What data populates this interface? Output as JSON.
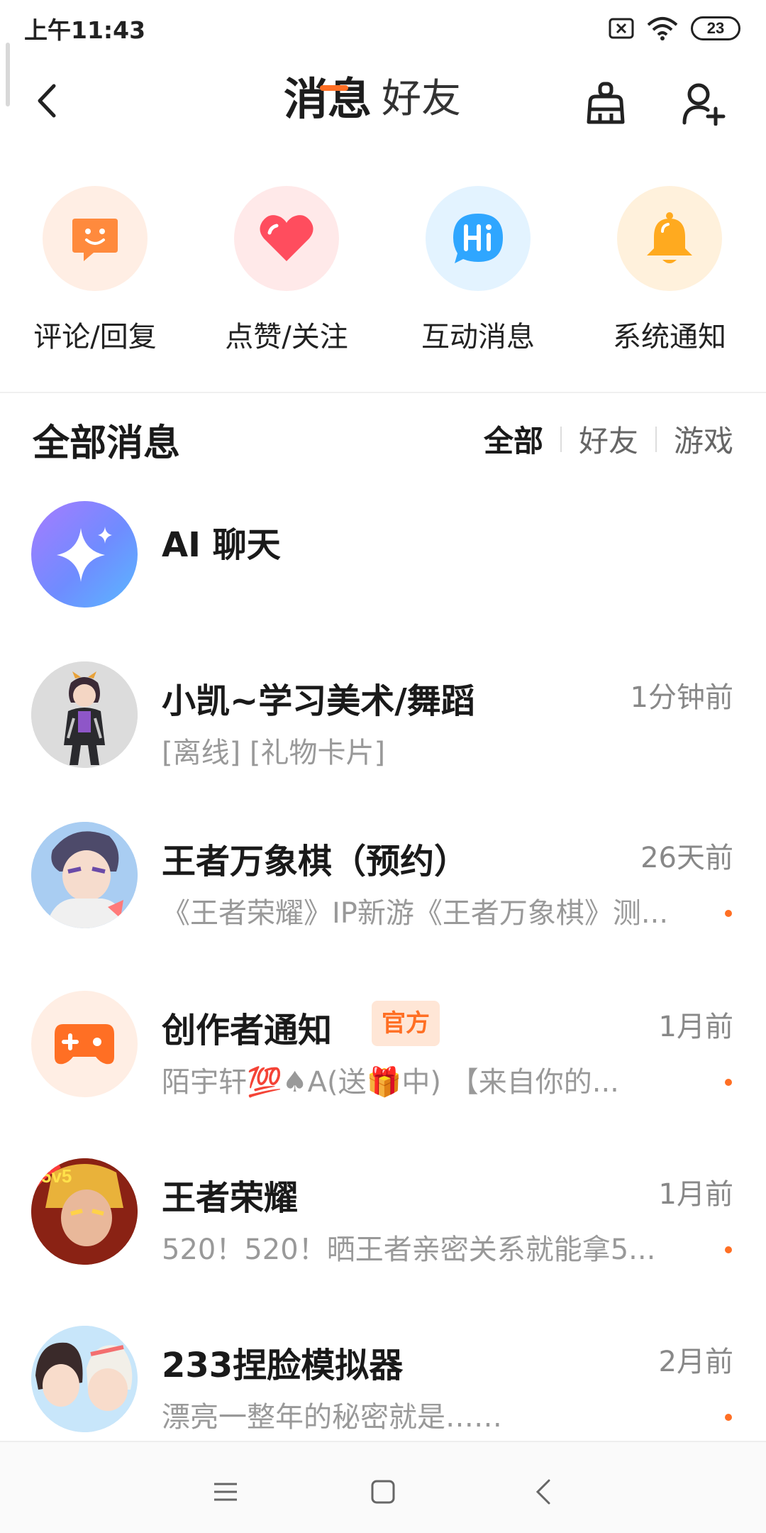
{
  "status_bar": {
    "time": "上午11:43",
    "battery": "23"
  },
  "header": {
    "tabs": [
      {
        "label": "消息",
        "active": true
      },
      {
        "label": "好友",
        "active": false
      }
    ],
    "accent_color": "#ff6f24"
  },
  "quick_entries": [
    {
      "label": "评论/回复",
      "icon": "chat-smile-icon",
      "bg": "#ffeee4",
      "color": "#ff8a3d"
    },
    {
      "label": "点赞/关注",
      "icon": "heart-icon",
      "bg": "#ffe9e9",
      "color": "#ff4d5e"
    },
    {
      "label": "互动消息",
      "icon": "hi-bubble-icon",
      "bg": "#e3f3ff",
      "color": "#2fa6ff"
    },
    {
      "label": "系统通知",
      "icon": "bell-icon",
      "bg": "#fff1dc",
      "color": "#ffaa1f"
    }
  ],
  "section": {
    "title": "全部消息",
    "filters": [
      "全部",
      "好友",
      "游戏"
    ],
    "active_filter": "全部"
  },
  "conversations": [
    {
      "name": "AI 聊天",
      "time": "",
      "preview": "",
      "unread": false,
      "official": false,
      "avatar": "ai-sparkle-icon"
    },
    {
      "name": "小凯~学习美术/舞蹈",
      "time": "1分钟前",
      "preview": "[离线] [礼物卡片]",
      "unread": false,
      "official": false,
      "avatar": "user-avatar"
    },
    {
      "name": "王者万象棋（预约）",
      "time": "26天前",
      "preview": "《王者荣耀》IP新游《王者万象棋》测...",
      "unread": true,
      "official": false,
      "avatar": "game-avatar"
    },
    {
      "name": "创作者通知",
      "time": "1月前",
      "preview": "陌宇轩💯♠A(送🎁中) 【来自你的...",
      "unread": true,
      "official": true,
      "official_label": "官方",
      "avatar": "gamepad-icon"
    },
    {
      "name": "王者荣耀",
      "time": "1月前",
      "preview": "520！520！晒王者亲密关系就能拿5...",
      "unread": true,
      "official": false,
      "avatar": "game-avatar"
    },
    {
      "name": "233捏脸模拟器",
      "time": "2月前",
      "preview": "漂亮一整年的秘密就是……",
      "unread": true,
      "official": false,
      "avatar": "game-avatar"
    }
  ],
  "bottom_nav": [
    "menu-icon",
    "home-square-icon",
    "back-icon"
  ]
}
